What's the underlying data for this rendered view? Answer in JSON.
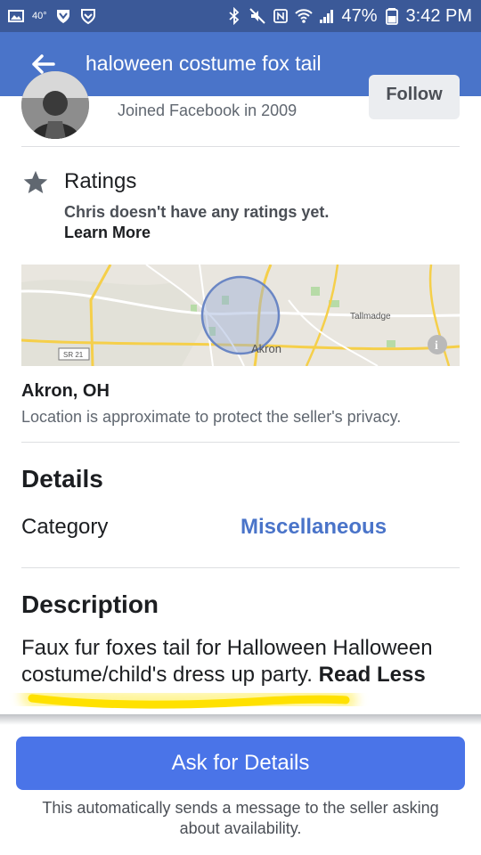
{
  "status_bar": {
    "temperature": "40°",
    "battery_percent": "47%",
    "time": "3:42 PM"
  },
  "app_bar": {
    "title": "haloween costume fox tail"
  },
  "seller": {
    "joined": "Joined Facebook in 2009",
    "follow_label": "Follow"
  },
  "ratings": {
    "title": "Ratings",
    "note": "Chris doesn't have any ratings yet.",
    "learn_more": "Learn More"
  },
  "map": {
    "label_city": "Akron",
    "label_town": "Tallmadge",
    "label_route": "SR 21"
  },
  "location": {
    "city": "Akron, OH",
    "note": "Location is approximate to protect the seller's privacy."
  },
  "details": {
    "heading": "Details",
    "category_label": "Category",
    "category_value": "Miscellaneous"
  },
  "description": {
    "heading": "Description",
    "text": "Faux fur foxes tail for Halloween Halloween costume/child's dress up party.",
    "read_less": "Read Less"
  },
  "footer": {
    "ask_button": "Ask for Details",
    "note": "This automatically sends a message to the seller asking about availability."
  },
  "colors": {
    "app_bar": "#4a74c9",
    "status_bar": "#3b5998",
    "accent": "#4a74c9",
    "button": "#4a74e8",
    "highlight": "#ffe100"
  }
}
